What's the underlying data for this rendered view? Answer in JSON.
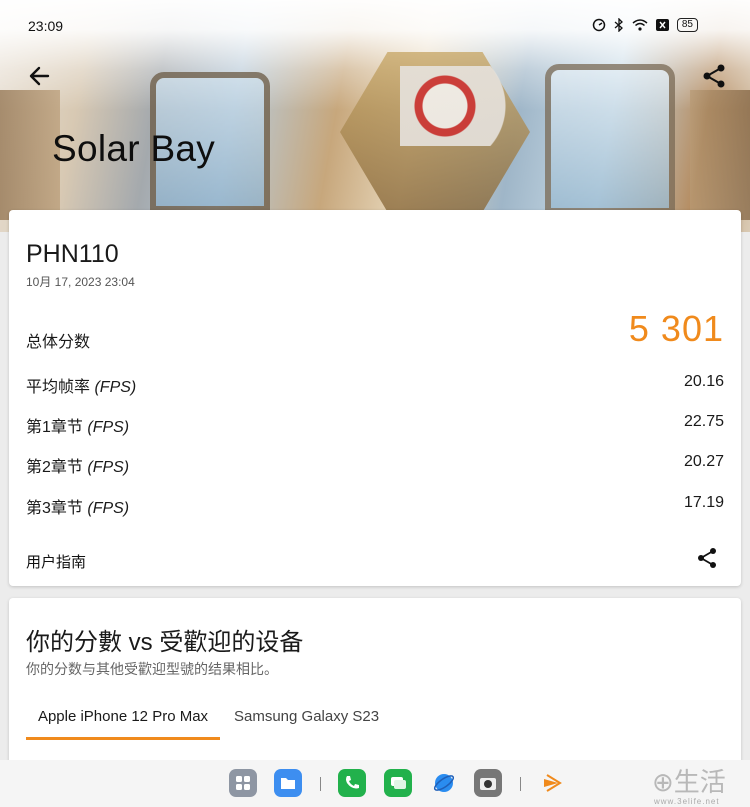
{
  "status_bar": {
    "time": "23:09",
    "battery": "85"
  },
  "header": {
    "title": "Solar Bay"
  },
  "result": {
    "device": "PHN110",
    "date": "10月 17, 2023 23:04",
    "total_label": "总体分数",
    "total_value": "5 301",
    "rows": [
      {
        "label": "平均帧率",
        "unit": "(FPS)",
        "value": "20.16"
      },
      {
        "label": "第1章节",
        "unit": "(FPS)",
        "value": "22.75"
      },
      {
        "label": "第2章节",
        "unit": "(FPS)",
        "value": "20.27"
      },
      {
        "label": "第3章节",
        "unit": "(FPS)",
        "value": "17.19"
      }
    ],
    "guide_label": "用户指南"
  },
  "compare": {
    "title": "你的分數 vs 受歡迎的设备",
    "subtitle": "你的分数与其他受歡迎型號的结果相比。",
    "tabs": [
      {
        "label": "Apple iPhone 12 Pro Max",
        "active": true
      },
      {
        "label": "Samsung Galaxy S23",
        "active": false
      }
    ]
  },
  "watermark": {
    "text": "生活",
    "sub": "www.3elife.net"
  },
  "colors": {
    "accent": "#f08a1c"
  }
}
